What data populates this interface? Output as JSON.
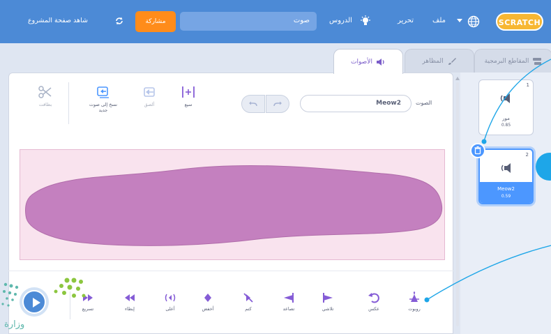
{
  "menubar": {
    "logo": "SCRATCH",
    "file": "ملف",
    "edit": "تحرير",
    "tutorials": "الدروس",
    "project_title": "صوت",
    "share": "مشاركة",
    "see_project_page": "شاهد صفحة المشروع"
  },
  "tabs": {
    "code": "المقاطع البرمجية",
    "costumes": "المظاهر",
    "sounds": "الأصوات"
  },
  "editor": {
    "sound_label": "الصوت",
    "sound_name": "Meow2",
    "tools": {
      "trim": "سيع",
      "paste": "ألصق",
      "copy_to_new": "نسخ إلى صوت جديد",
      "delete": "بطاقت"
    }
  },
  "effects": [
    {
      "label": "روبوت",
      "icon": "robot-icon"
    },
    {
      "label": "عكس",
      "icon": "reverse-icon"
    },
    {
      "label": "تلاشي",
      "icon": "fade-out-icon"
    },
    {
      "label": "تصاعد",
      "icon": "fade-in-icon"
    },
    {
      "label": "كتم",
      "icon": "mute-icon"
    },
    {
      "label": "أخفض",
      "icon": "softer-icon"
    },
    {
      "label": "أعلى",
      "icon": "louder-icon"
    },
    {
      "label": "إبطاء",
      "icon": "slower-icon"
    },
    {
      "label": "تسريع",
      "icon": "faster-icon"
    }
  ],
  "sound_list": [
    {
      "number": "1",
      "name": "مور",
      "duration": "0.85"
    },
    {
      "number": "2",
      "name": "Meow2",
      "duration": "0.59"
    }
  ],
  "watermark_text": "وزارة",
  "colors": {
    "menubar": "#4c8ad6",
    "share": "#ff8c1a",
    "waveform": "#c480bf",
    "accent": "#4c97ff",
    "callout": "#1ea6e8"
  }
}
